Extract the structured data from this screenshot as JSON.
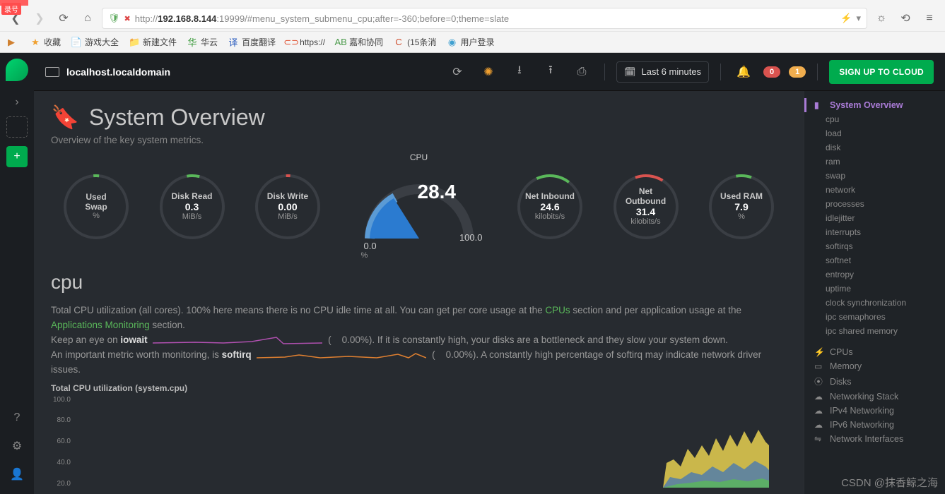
{
  "browser": {
    "rec_badge": "录号",
    "url_prefix": "http://",
    "url_bold": "192.168.8.144",
    "url_rest": ":19999/#menu_system_submenu_cpu;after=-360;before=0;theme=slate",
    "bookmarks": [
      {
        "icon": "▶",
        "label": "",
        "color": "#d08030"
      },
      {
        "icon": "★",
        "label": "收藏",
        "color": "#f0a030"
      },
      {
        "icon": "📄",
        "label": "游戏大全",
        "color": "#888"
      },
      {
        "icon": "📁",
        "label": "新建文件",
        "color": "#e8a030"
      },
      {
        "icon": "华",
        "label": "华云",
        "color": "#3a9a3a"
      },
      {
        "icon": "译",
        "label": "百度翻译",
        "color": "#3060c0"
      },
      {
        "icon": "⊂⊃",
        "label": "https://",
        "color": "#e05030"
      },
      {
        "icon": "AB",
        "label": "嘉和协同",
        "color": "#4a9a4a"
      },
      {
        "icon": "C",
        "label": "(15条消",
        "color": "#d05030"
      },
      {
        "icon": "◉",
        "label": "用户登录",
        "color": "#40a0d0"
      }
    ]
  },
  "topbar": {
    "host": "localhost.localdomain",
    "time_range": "Last 6 minutes",
    "alert_red": "0",
    "alert_yellow": "1",
    "signup": "SIGN UP TO CLOUD"
  },
  "page": {
    "title": "System Overview",
    "subtitle": "Overview of the key system metrics."
  },
  "gauges": {
    "used_swap": {
      "label": "Used\nSwap",
      "value": "",
      "unit": "%"
    },
    "disk_read": {
      "label": "Disk Read",
      "value": "0.3",
      "unit": "MiB/s"
    },
    "disk_write": {
      "label": "Disk Write",
      "value": "0.00",
      "unit": "MiB/s"
    },
    "cpu": {
      "label": "CPU",
      "value": "28.4",
      "min": "0.0",
      "max": "100.0",
      "unit": "%"
    },
    "net_in": {
      "label": "Net Inbound",
      "value": "24.6",
      "unit": "kilobits/s"
    },
    "net_out": {
      "label": "Net\nOutbound",
      "value": "31.4",
      "unit": "kilobits/s"
    },
    "used_ram": {
      "label": "Used RAM",
      "value": "7.9",
      "unit": "%"
    }
  },
  "cpu_section": {
    "head": "cpu",
    "desc1_a": "Total CPU utilization (all cores). 100% here means there is no CPU idle time at all. You can get per core usage at the ",
    "link1": "CPUs",
    "desc1_b": " section and per application usage at the ",
    "link2": "Applications Monitoring",
    "desc1_c": " section.",
    "desc2_a": "Keep an eye on ",
    "iowait": "iowait",
    "iowait_pct": "0.00%",
    "desc2_b": "). If it is constantly high, your disks are a bottleneck and they slow your system down.",
    "desc3_a": "An important metric worth monitoring, is ",
    "softirq": "softirq",
    "softirq_pct": "0.00%",
    "desc3_b": "). A constantly high percentage of softirq may indicate network driver issues.",
    "chart_title": "Total CPU utilization (system.cpu)"
  },
  "chart_data": {
    "type": "area",
    "title": "Total CPU utilization (system.cpu)",
    "ylabel": "%",
    "ylim": [
      0,
      100
    ],
    "yticks": [
      100.0,
      80.0,
      60.0,
      40.0,
      20.0
    ]
  },
  "toc": {
    "top": [
      {
        "id": "system-overview",
        "label": "System Overview",
        "icon": "▮",
        "active": true
      },
      {
        "id": "cpu",
        "label": "cpu",
        "lvl": 2
      },
      {
        "id": "load",
        "label": "load",
        "lvl": 2
      },
      {
        "id": "disk",
        "label": "disk",
        "lvl": 2
      },
      {
        "id": "ram",
        "label": "ram",
        "lvl": 2
      },
      {
        "id": "swap",
        "label": "swap",
        "lvl": 2
      },
      {
        "id": "network",
        "label": "network",
        "lvl": 2
      },
      {
        "id": "processes",
        "label": "processes",
        "lvl": 2
      },
      {
        "id": "idlejitter",
        "label": "idlejitter",
        "lvl": 2
      },
      {
        "id": "interrupts",
        "label": "interrupts",
        "lvl": 2
      },
      {
        "id": "softirqs",
        "label": "softirqs",
        "lvl": 2
      },
      {
        "id": "softnet",
        "label": "softnet",
        "lvl": 2
      },
      {
        "id": "entropy",
        "label": "entropy",
        "lvl": 2
      },
      {
        "id": "uptime",
        "label": "uptime",
        "lvl": 2
      },
      {
        "id": "clock-sync",
        "label": "clock synchronization",
        "lvl": 2
      },
      {
        "id": "ipc-sem",
        "label": "ipc semaphores",
        "lvl": 2
      },
      {
        "id": "ipc-shm",
        "label": "ipc shared memory",
        "lvl": 2
      }
    ],
    "bottom": [
      {
        "id": "cpus",
        "label": "CPUs",
        "icon": "⚡"
      },
      {
        "id": "memory",
        "label": "Memory",
        "icon": "▭"
      },
      {
        "id": "disks",
        "label": "Disks",
        "icon": "⦿"
      },
      {
        "id": "net-stack",
        "label": "Networking Stack",
        "icon": "☁"
      },
      {
        "id": "ipv4",
        "label": "IPv4 Networking",
        "icon": "☁"
      },
      {
        "id": "ipv6",
        "label": "IPv6 Networking",
        "icon": "☁"
      },
      {
        "id": "net-if",
        "label": "Network Interfaces",
        "icon": "⇋"
      }
    ]
  },
  "watermark": "CSDN @抹香鲸之海"
}
